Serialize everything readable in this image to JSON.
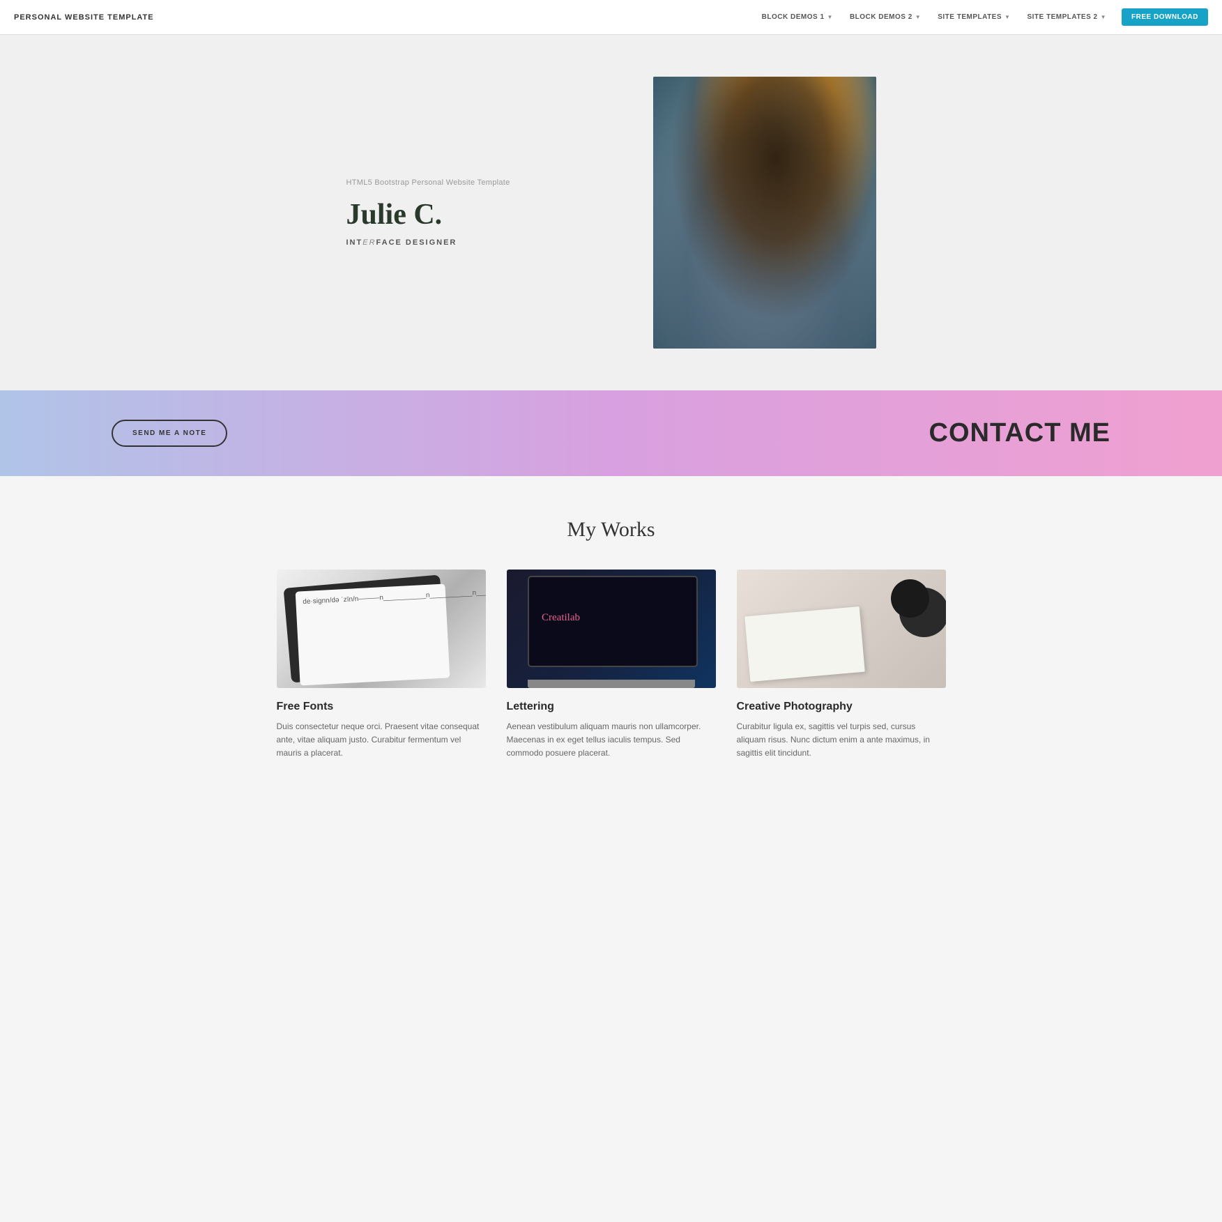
{
  "navbar": {
    "brand": "PERSONAL WEBSITE TEMPLATE",
    "links": [
      {
        "label": "BLOCK DEMOS 1",
        "hasDropdown": true
      },
      {
        "label": "BLOCK DEMOS 2",
        "hasDropdown": true
      },
      {
        "label": "SITE TEMPLATES",
        "hasDropdown": true
      },
      {
        "label": "SITE TEMPLATES 2",
        "hasDropdown": true
      }
    ],
    "download_label": "FREE DOWNLOAD"
  },
  "hero": {
    "subtitle": "HTML5 Bootstrap Personal Website Template",
    "name": "Julie C.",
    "role_prefix": "INT",
    "role_italic": "ER",
    "role_suffix": "FACE DESIGNER"
  },
  "contact": {
    "button_label": "SEND ME A NOTE",
    "title": "CONTACT ME"
  },
  "works": {
    "section_title": "My Works",
    "items": [
      {
        "name": "Free Fonts",
        "description": "Duis consectetur neque orci. Praesent vitae consequat ante, vitae aliquam justo. Curabitur fermentum vel mauris a placerat."
      },
      {
        "name": "Lettering",
        "description": "Aenean vestibulum aliquam mauris non ullamcorper. Maecenas in ex eget tellus iaculis tempus. Sed commodo posuere placerat."
      },
      {
        "name": "Creative Photography",
        "description": "Curabitur ligula ex, sagittis vel turpis sed, cursus aliquam risus. Nunc dictum enim a ante maximus, in sagittis elit tincidunt."
      }
    ]
  }
}
